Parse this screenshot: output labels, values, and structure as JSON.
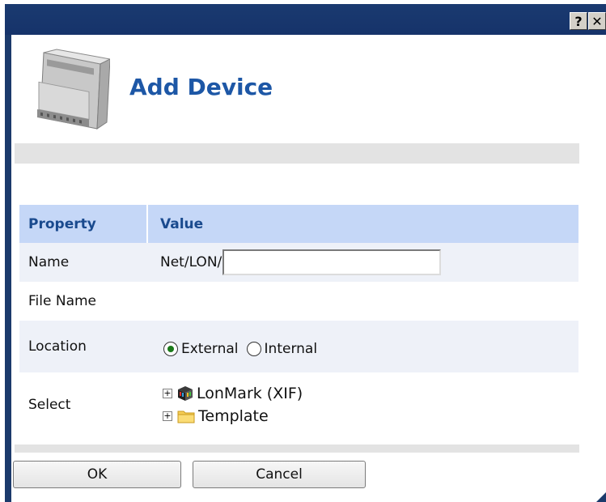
{
  "titlebar": {
    "help_glyph": "?",
    "close_glyph": "✕"
  },
  "header": {
    "title": "Add Device",
    "icon": "device-module-icon"
  },
  "table": {
    "columns": [
      "Property",
      "Value"
    ],
    "name": {
      "label": "Name",
      "prefix": "Net/LON/",
      "value": ""
    },
    "file_name": {
      "label": "File Name",
      "value": ""
    },
    "location": {
      "label": "Location",
      "options": [
        "External",
        "Internal"
      ],
      "selected": "External"
    },
    "select": {
      "label": "Select",
      "tree": [
        {
          "label": "LonMark (XIF)",
          "icon": "lonmark-cube-icon"
        },
        {
          "label": "Template",
          "icon": "folder-icon"
        }
      ]
    }
  },
  "buttons": {
    "ok": "OK",
    "cancel": "Cancel"
  },
  "colors": {
    "titlebar": "#1b3a6b",
    "heading": "#1d57a6",
    "table_header": "#c5d7f7"
  }
}
